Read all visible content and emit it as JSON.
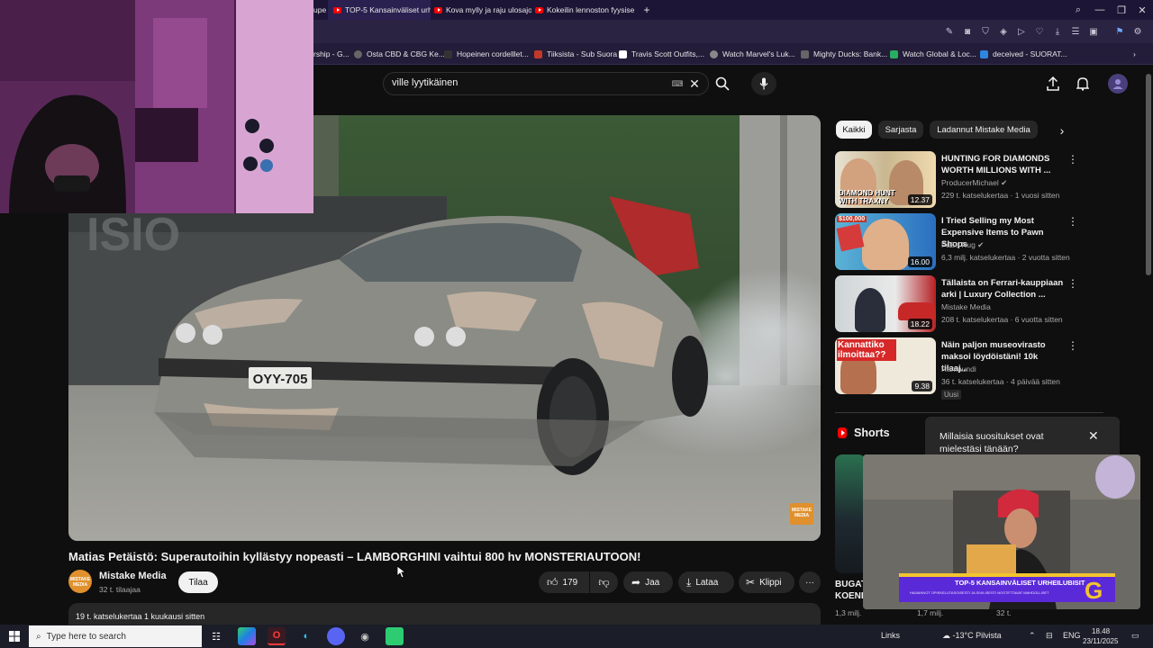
{
  "browser": {
    "tabs": [
      {
        "label": "TOP-5 Kansainväliset urhe"
      },
      {
        "label": "Kova mylly ja raju ulosajo"
      },
      {
        "label": "Kokeilin lennoston fyysise"
      }
    ],
    "partial_tab_label": "upe",
    "new_tab_label": "+",
    "bookmarks": [
      {
        "label": "rship - G..."
      },
      {
        "label": "Osta CBD & CBG Ke..."
      },
      {
        "label": "Hopeinen cordelllet..."
      },
      {
        "label": "Tiiksista - Sub Suora"
      },
      {
        "label": "Travis Scott Outfits,..."
      },
      {
        "label": "Watch Marvel's Luk..."
      },
      {
        "label": "Mighty Ducks: Bank..."
      },
      {
        "label": "Watch Global & Loc..."
      },
      {
        "label": "deceived - SUORAT..."
      }
    ]
  },
  "youtube": {
    "search": {
      "value": "ville lyytikäinen"
    },
    "player": {
      "watermark": "MISTAKE MEDIA",
      "plate": "OYY-705"
    },
    "video": {
      "title": "Matias Petäistö: Superautoihin kyllästyy nopeasti – LAMBORGHINI vaihtui 800 hv MONSTERIAUTOON!",
      "channel": "Mistake Media",
      "channel_avatar_text": "MISTAKE MEDIA",
      "subscribers": "32 t. tilaajaa",
      "subscribe_label": "Tilaa",
      "likes": "179",
      "share_label": "Jaa",
      "download_label": "Lataa",
      "clip_label": "Klippi",
      "views_date": "19 t. katselukertaa  1 kuukausi sitten"
    },
    "chips": [
      "Kaikki",
      "Sarjasta",
      "Ladannut Mistake Media"
    ],
    "recommendations": [
      {
        "title": "HUNTING FOR DIAMONDS WORTH MILLIONS WITH ...",
        "channel": "ProducerMichael",
        "meta": "229 t. katselukertaa · 1 vuosi sitten",
        "duration": "12.37",
        "thumb_text": "DIAMOND HUNT WITH TRAXNY"
      },
      {
        "title": "I Tried Selling my Most Expensive Items to Pawn Shops",
        "channel": "FaZe Rug",
        "meta": "6,3 milj. katselukertaa · 2 vuotta sitten",
        "duration": "16.00",
        "thumb_text": "$100,000"
      },
      {
        "title": "Tällaista on Ferrari-kauppiaan arki | Luxury Collection ...",
        "channel": "Mistake Media",
        "meta": "208 t. katselukertaa · 6 vuotta sitten",
        "duration": "18.22",
        "thumb_text": ""
      },
      {
        "title": "Näin paljon museovirasto maksoi löydöistäni! 10k tilaaj...",
        "channel": "Ramaundi",
        "meta": "36 t. katselukertaa · 4 päivää sitten",
        "duration": "9.38",
        "thumb_text": "Kannattiko ilmoittaa??",
        "badge": "Uusi"
      }
    ],
    "shorts": {
      "header": "Shorts",
      "survey_question": "Millaisia suositukset ovat mielestäsi tänään?",
      "items": [
        {
          "title": "BUGAT KOENI",
          "meta": "1,3 milj."
        },
        {
          "meta": "1,7 milj."
        },
        {
          "meta": "32 t."
        }
      ]
    }
  },
  "stream_overlay": {
    "banner_title": "TOP-5 KANSAINVÄLISET URHEILUBISIT",
    "banner_sub": "HAVAINNOT OPISKELUTASOISESTI JA SIVILISESTI NOSTETTAVAT MAHDOLLISET",
    "logo_letter": "G"
  },
  "taskbar": {
    "search_placeholder": "Type here to search",
    "links_label": "Links",
    "weather": "-13°C  Pilvista",
    "language": "ENG",
    "time": "18.48",
    "date": "23/11/2025"
  },
  "colors": {
    "yt_background": "#0f0f0f",
    "yt_red": "#ff0000",
    "browser_tab_bg": "#1c1535",
    "browser_toolbar_bg": "#2b2342",
    "banner_purple": "#5b2ad8",
    "banner_yellow": "#f3c52e"
  }
}
